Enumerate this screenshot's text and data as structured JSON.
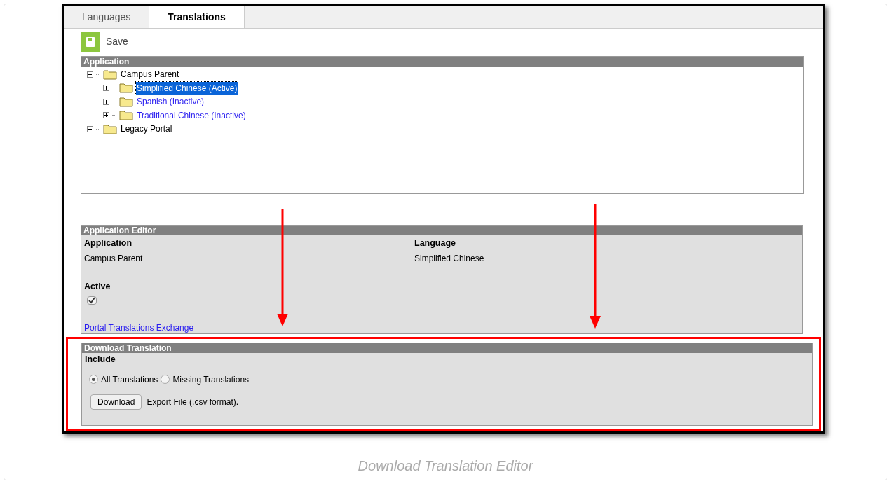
{
  "tabs": [
    {
      "label": "Languages",
      "selected": false
    },
    {
      "label": "Translations",
      "selected": true
    }
  ],
  "toolbar": {
    "save_label": "Save"
  },
  "application_tree": {
    "title": "Application",
    "items": [
      {
        "label": "Campus Parent",
        "expanded": true,
        "selected": false,
        "children": [
          {
            "label": "Simplified Chinese (Active)",
            "expanded": false,
            "selected": true
          },
          {
            "label": "Spanish (Inactive)",
            "expanded": false,
            "selected": false
          },
          {
            "label": "Traditional Chinese (Inactive)",
            "expanded": false,
            "selected": false
          }
        ]
      },
      {
        "label": "Legacy Portal",
        "expanded": false,
        "selected": false
      }
    ]
  },
  "application_editor": {
    "title": "Application Editor",
    "fields": [
      {
        "label": "Application",
        "value": "Campus Parent"
      },
      {
        "label": "Language",
        "value": "Simplified Chinese"
      }
    ],
    "active_label": "Active",
    "active_checked": true,
    "link": "Portal Translations Exchange"
  },
  "download_translation": {
    "title": "Download Translation",
    "include_label": "Include",
    "options": [
      {
        "label": "All Translations",
        "selected": true
      },
      {
        "label": "Missing Translations",
        "selected": false
      }
    ],
    "button": "Download",
    "note": "Export File (.csv format)."
  },
  "caption": "Download Translation Editor"
}
